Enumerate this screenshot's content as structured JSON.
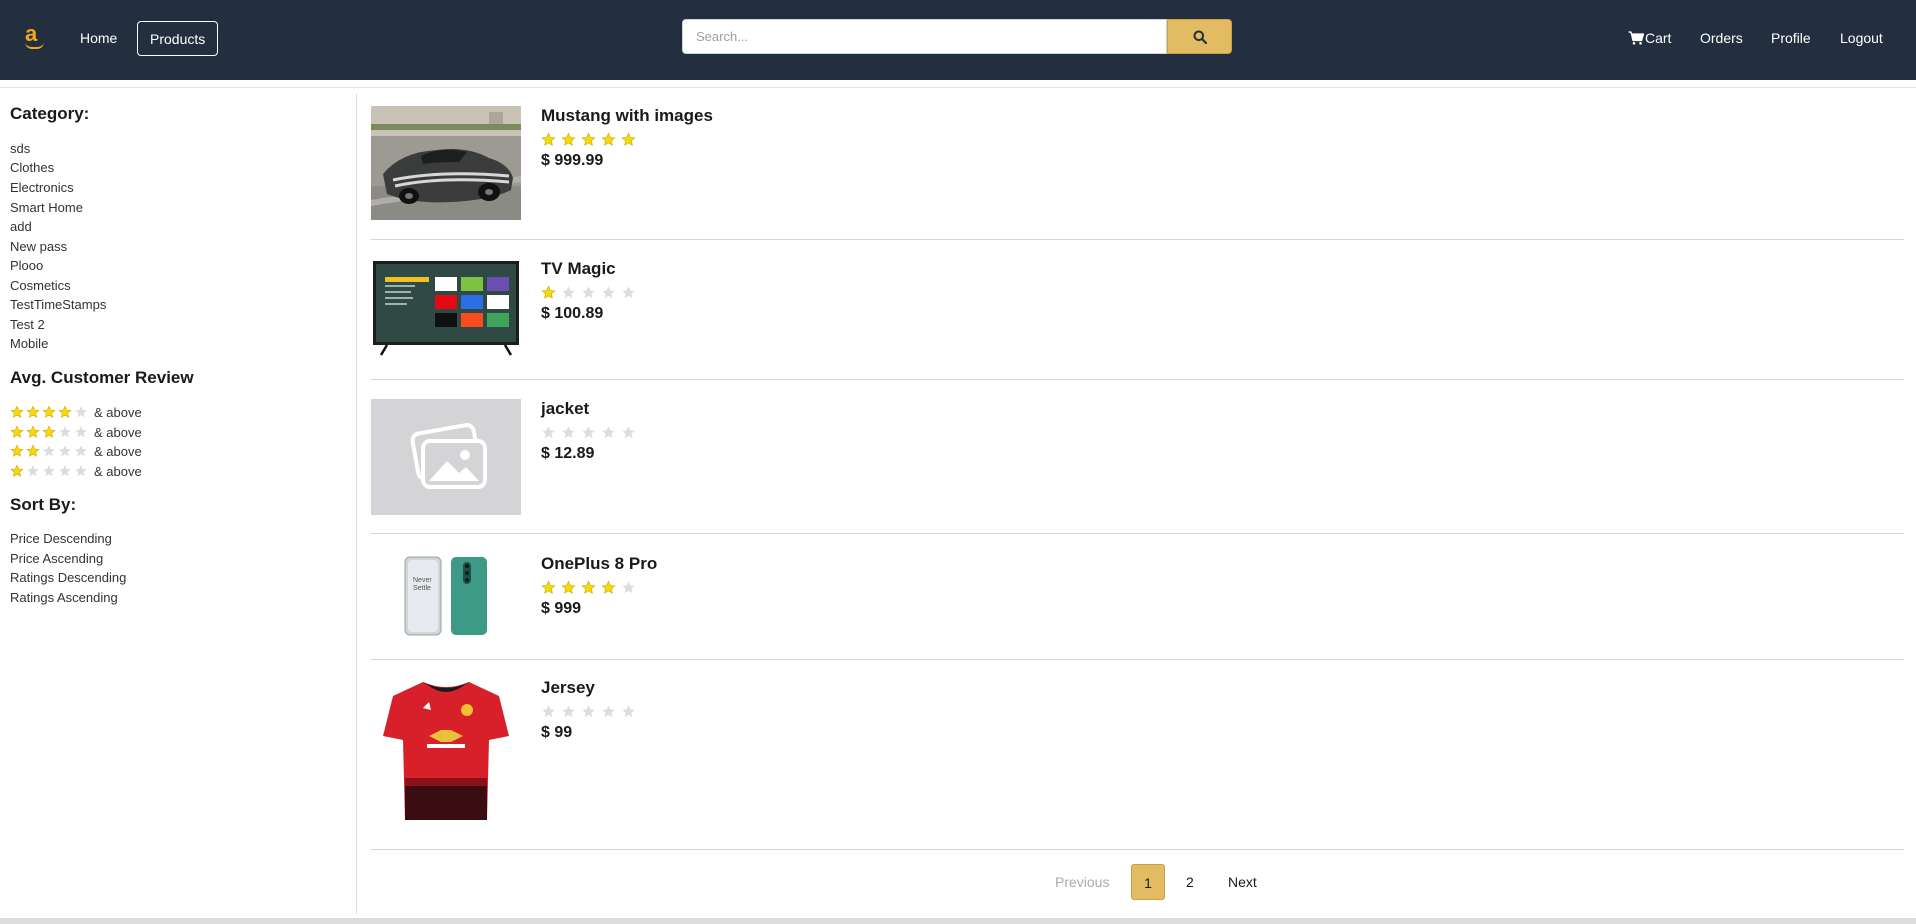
{
  "nav": {
    "home": "Home",
    "products": "Products",
    "search_placeholder": "Search...",
    "cart": "Cart",
    "orders": "Orders",
    "profile": "Profile",
    "logout": "Logout",
    "logo_letter": "a"
  },
  "sidebar": {
    "category_heading": "Category:",
    "categories": [
      "sds",
      "Clothes",
      "Electronics",
      "Smart Home",
      "add",
      "New pass",
      "Plooo",
      "Cosmetics",
      "TestTimeStamps",
      "Test 2",
      "Mobile"
    ],
    "review_heading": "Avg. Customer Review",
    "reviews": [
      {
        "stars": 4,
        "label": "& above"
      },
      {
        "stars": 3,
        "label": "& above"
      },
      {
        "stars": 2,
        "label": "& above"
      },
      {
        "stars": 1,
        "label": "& above"
      }
    ],
    "sort_heading": "Sort By:",
    "sort_options": [
      "Price Descending",
      "Price Ascending",
      "Ratings Descending",
      "Ratings Ascending"
    ]
  },
  "products": [
    {
      "name": "Mustang with images",
      "rating": 5,
      "price": "$ 999.99",
      "image": "car-photo"
    },
    {
      "name": "TV Magic",
      "rating": 1,
      "price": "$ 100.89",
      "image": "tv-photo"
    },
    {
      "name": "jacket",
      "rating": 0,
      "price": "$ 12.89",
      "image": "placeholder-image-icon"
    },
    {
      "name": "OnePlus 8 Pro",
      "rating": 4,
      "price": "$ 999",
      "image": "phone-photo"
    },
    {
      "name": "Jersey",
      "rating": 0,
      "price": "$ 99",
      "image": "jersey-photo"
    }
  ],
  "pagination": {
    "previous": "Previous",
    "pages": [
      "1",
      "2"
    ],
    "current": "1",
    "next": "Next"
  },
  "colors": {
    "navbar": "#232f3e",
    "accent": "#e2bb63",
    "star_filled": "#f5d90a",
    "star_empty": "#dddddd"
  }
}
